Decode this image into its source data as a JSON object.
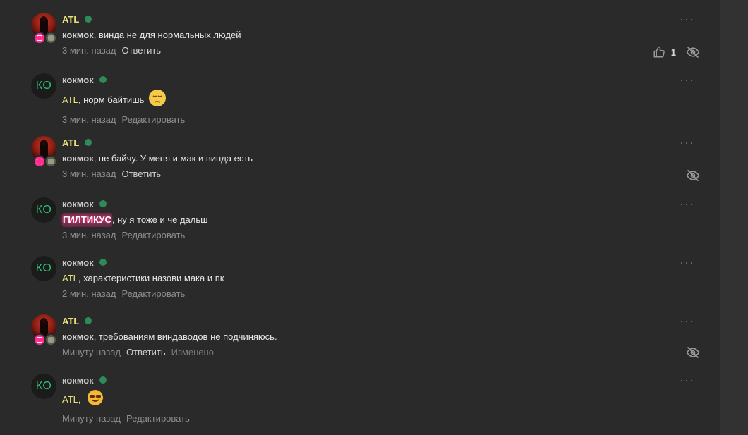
{
  "comments": [
    {
      "author": "ATL",
      "text_mention": "кокмок",
      "text_rest": ", винда не для нормальных людей",
      "time": "3 мин. назад",
      "action": "Ответить",
      "likes": "1"
    },
    {
      "author": "кокмок",
      "avatar_initials": "КО",
      "text_mention": "ATL",
      "text_rest": ", норм байтишь",
      "emoji": "pensive-face-emoji",
      "time": "3 мин. назад",
      "action": "Редактировать"
    },
    {
      "author": "ATL",
      "text_mention": "кокмок",
      "text_rest": ", не байчу. У меня и мак и винда есть",
      "time": "3 мин. назад",
      "action": "Ответить"
    },
    {
      "author": "кокмок",
      "avatar_initials": "КО",
      "text_mention": "ГИЛТИКУС",
      "text_rest": ", ну я тоже и че дальш",
      "time": "3 мин. назад",
      "action": "Редактировать"
    },
    {
      "author": "кокмок",
      "avatar_initials": "КО",
      "text_mention": "ATL",
      "text_rest": ", характеристики назови мака и пк",
      "time": "2 мин. назад",
      "action": "Редактировать"
    },
    {
      "author": "ATL",
      "text_mention": "кокмок",
      "text_rest": ", требованиям виндаводов не подчиняюсь.",
      "time": "Минуту назад",
      "action": "Ответить",
      "edited": "Изменено"
    },
    {
      "author": "кокмок",
      "avatar_initials": "КО",
      "text_mention": "ATL",
      "text_rest": ",",
      "emoji": "sunglasses-face-emoji",
      "time": "Минуту назад",
      "action": "Редактировать"
    }
  ],
  "icons": {
    "more": "more-dots-icon",
    "like": "thumbs-up-icon",
    "hide": "eye-slash-icon"
  },
  "colors": {
    "background": "#2a2a2a",
    "atl_name": "#e8e07a",
    "online": "#2e8b57",
    "initials": "#2fbf71",
    "glow_mention": "#ff3d8d"
  }
}
